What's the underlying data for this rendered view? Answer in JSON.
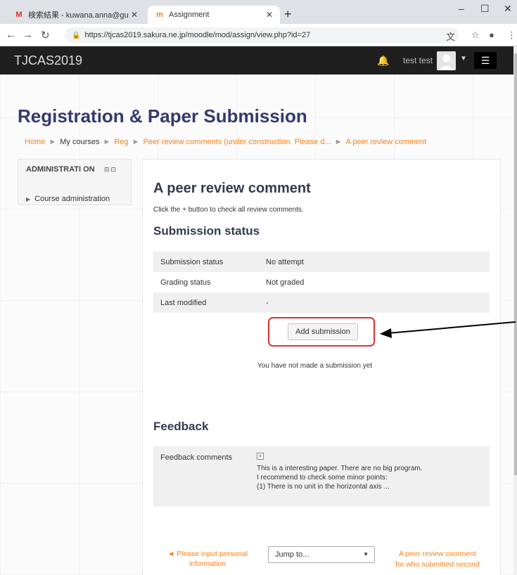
{
  "browser": {
    "tabs": [
      {
        "label": "検索結果 - kuwana.anna@gunma",
        "icon": "gmail-icon"
      },
      {
        "label": "Assignment",
        "icon": "moodle-icon"
      }
    ],
    "url": "https://tjcas2019.sakura.ne.jp/moodle/mod/assign/view.php?id=27"
  },
  "navbar": {
    "brand": "TJCAS2019",
    "user": "test test"
  },
  "header": {
    "title": "Registration & Paper Submission"
  },
  "breadcrumb": [
    "Home",
    "My courses",
    "Reg",
    "Peer review comments (under construction. Please d...",
    "A peer review comment"
  ],
  "admin_block": {
    "title": "ADMINISTRATI ON",
    "item": "Course administration"
  },
  "assignment": {
    "title": "A peer review comment",
    "intro": "Click the + button to check all review comments."
  },
  "submission": {
    "heading": "Submission status",
    "rows": [
      {
        "label": "Submission status",
        "value": "No attempt"
      },
      {
        "label": "Grading status",
        "value": "Not graded"
      },
      {
        "label": "Last modified",
        "value": "-"
      }
    ],
    "button": "Add submission",
    "note": "You have not made a submission yet"
  },
  "feedback": {
    "heading": "Feedback",
    "label": "Feedback comments",
    "lines": [
      "This is a interesting paper. There are no big program.",
      "I recommend to check some minor points:",
      "(1) There is no unit in the horizontal axis ..."
    ]
  },
  "footer_nav": {
    "prev_line1": "◄ Please input personal",
    "prev_line2": "information",
    "jump": "Jump to...",
    "next_line1": "A peer review comment",
    "next_line2": "for who submitted second"
  },
  "colors": {
    "link": "#f98012",
    "title": "#343a6e",
    "annotation": "#e03030"
  }
}
